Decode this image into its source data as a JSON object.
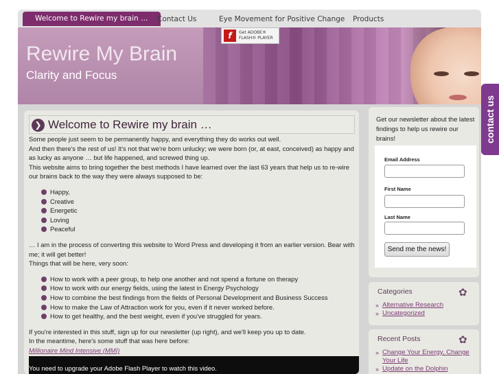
{
  "nav": {
    "items": [
      {
        "label": "Welcome to Rewire my brain …",
        "active": true
      },
      {
        "label": "Contact Us"
      },
      {
        "label": "Eye Movement for Positive Change"
      },
      {
        "label": "Products"
      }
    ]
  },
  "header": {
    "title": "Rewire My Brain",
    "subtitle": "Clarity and Focus",
    "flash_badge": {
      "logo": "f",
      "text_line1": "Get ADOBE®",
      "text_line2": "FLASH® PLAYER"
    }
  },
  "contact_tab": {
    "label": "contact us"
  },
  "main": {
    "title": "Welcome to Rewire my brain …",
    "intro": [
      "Some people just seem to be permanently happy, and everything they do works out well.",
      "And then there's the rest of us!  It's not that we're born unlucky; we were born (or, at east, conceived) as happy and as lucky as anyone … but life happened, and screwed thing up.",
      "This website aims to bring together the best methods I have learned over the last 63 years that help us to re-wire our brains back to the way they were always supposed to be:"
    ],
    "states": [
      "Happy,",
      "Creative",
      "Energetic",
      "Loving",
      "Peaceful"
    ],
    "middle": [
      "… I am in the process of converting this website to Word Press and developing it from an earlier version.  Bear with me; it will get better!",
      "Things that will be here, very soon:"
    ],
    "coming_soon": [
      "How to work with a peer group, to help one another and not spend a fortune on therapy",
      "How to work with our energy fields, using the latest in Energy Psychology",
      "How to combine the best findings from the fields of Personal Development and Business Success",
      "How to make the Law of Attraction work for you, even if it never worked before.",
      "How to get healthy, and the best weight, even if you've struggled for years."
    ],
    "outro": [
      "If you're interested in this stuff, sign up for our newsletter (up right), and we'll keep you up to date.",
      "In the meantime, here's some stuff that was here before:"
    ],
    "mmi_link": "Millionaire Mind Intensive (MMI)",
    "video_message": "You need to upgrade your Adobe Flash Player to watch this video."
  },
  "sidebar": {
    "newsletter_text": "Get our newsletter about the latest findings to help us rewire our brains!",
    "form": {
      "email_label": "Email Address",
      "email_value": "",
      "first_name_label": "First Name",
      "first_name_value": "",
      "last_name_label": "Last Name",
      "last_name_value": "",
      "submit_label": "Send me the news!"
    },
    "categories": {
      "heading": "Categories",
      "items": [
        "Alternative Research",
        "Uncategorized"
      ]
    },
    "recent_posts": {
      "heading": "Recent Posts",
      "items": [
        "Change Your Energy, Change Your Life",
        "Update on the Dolphin"
      ]
    }
  },
  "colors": {
    "accent": "#7d2c6c",
    "link": "#7b3a72",
    "contact_tab": "#7d3a8f"
  }
}
